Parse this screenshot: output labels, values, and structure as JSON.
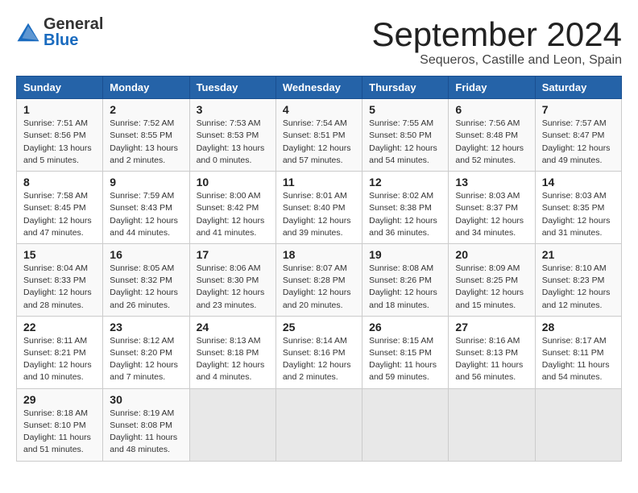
{
  "header": {
    "logo_line1": "General",
    "logo_line2": "Blue",
    "month_title": "September 2024",
    "location": "Sequeros, Castille and Leon, Spain"
  },
  "columns": [
    "Sunday",
    "Monday",
    "Tuesday",
    "Wednesday",
    "Thursday",
    "Friday",
    "Saturday"
  ],
  "weeks": [
    [
      {
        "day": "1",
        "info": "Sunrise: 7:51 AM\nSunset: 8:56 PM\nDaylight: 13 hours\nand 5 minutes."
      },
      {
        "day": "2",
        "info": "Sunrise: 7:52 AM\nSunset: 8:55 PM\nDaylight: 13 hours\nand 2 minutes."
      },
      {
        "day": "3",
        "info": "Sunrise: 7:53 AM\nSunset: 8:53 PM\nDaylight: 13 hours\nand 0 minutes."
      },
      {
        "day": "4",
        "info": "Sunrise: 7:54 AM\nSunset: 8:51 PM\nDaylight: 12 hours\nand 57 minutes."
      },
      {
        "day": "5",
        "info": "Sunrise: 7:55 AM\nSunset: 8:50 PM\nDaylight: 12 hours\nand 54 minutes."
      },
      {
        "day": "6",
        "info": "Sunrise: 7:56 AM\nSunset: 8:48 PM\nDaylight: 12 hours\nand 52 minutes."
      },
      {
        "day": "7",
        "info": "Sunrise: 7:57 AM\nSunset: 8:47 PM\nDaylight: 12 hours\nand 49 minutes."
      }
    ],
    [
      {
        "day": "8",
        "info": "Sunrise: 7:58 AM\nSunset: 8:45 PM\nDaylight: 12 hours\nand 47 minutes."
      },
      {
        "day": "9",
        "info": "Sunrise: 7:59 AM\nSunset: 8:43 PM\nDaylight: 12 hours\nand 44 minutes."
      },
      {
        "day": "10",
        "info": "Sunrise: 8:00 AM\nSunset: 8:42 PM\nDaylight: 12 hours\nand 41 minutes."
      },
      {
        "day": "11",
        "info": "Sunrise: 8:01 AM\nSunset: 8:40 PM\nDaylight: 12 hours\nand 39 minutes."
      },
      {
        "day": "12",
        "info": "Sunrise: 8:02 AM\nSunset: 8:38 PM\nDaylight: 12 hours\nand 36 minutes."
      },
      {
        "day": "13",
        "info": "Sunrise: 8:03 AM\nSunset: 8:37 PM\nDaylight: 12 hours\nand 34 minutes."
      },
      {
        "day": "14",
        "info": "Sunrise: 8:03 AM\nSunset: 8:35 PM\nDaylight: 12 hours\nand 31 minutes."
      }
    ],
    [
      {
        "day": "15",
        "info": "Sunrise: 8:04 AM\nSunset: 8:33 PM\nDaylight: 12 hours\nand 28 minutes."
      },
      {
        "day": "16",
        "info": "Sunrise: 8:05 AM\nSunset: 8:32 PM\nDaylight: 12 hours\nand 26 minutes."
      },
      {
        "day": "17",
        "info": "Sunrise: 8:06 AM\nSunset: 8:30 PM\nDaylight: 12 hours\nand 23 minutes."
      },
      {
        "day": "18",
        "info": "Sunrise: 8:07 AM\nSunset: 8:28 PM\nDaylight: 12 hours\nand 20 minutes."
      },
      {
        "day": "19",
        "info": "Sunrise: 8:08 AM\nSunset: 8:26 PM\nDaylight: 12 hours\nand 18 minutes."
      },
      {
        "day": "20",
        "info": "Sunrise: 8:09 AM\nSunset: 8:25 PM\nDaylight: 12 hours\nand 15 minutes."
      },
      {
        "day": "21",
        "info": "Sunrise: 8:10 AM\nSunset: 8:23 PM\nDaylight: 12 hours\nand 12 minutes."
      }
    ],
    [
      {
        "day": "22",
        "info": "Sunrise: 8:11 AM\nSunset: 8:21 PM\nDaylight: 12 hours\nand 10 minutes."
      },
      {
        "day": "23",
        "info": "Sunrise: 8:12 AM\nSunset: 8:20 PM\nDaylight: 12 hours\nand 7 minutes."
      },
      {
        "day": "24",
        "info": "Sunrise: 8:13 AM\nSunset: 8:18 PM\nDaylight: 12 hours\nand 4 minutes."
      },
      {
        "day": "25",
        "info": "Sunrise: 8:14 AM\nSunset: 8:16 PM\nDaylight: 12 hours\nand 2 minutes."
      },
      {
        "day": "26",
        "info": "Sunrise: 8:15 AM\nSunset: 8:15 PM\nDaylight: 11 hours\nand 59 minutes."
      },
      {
        "day": "27",
        "info": "Sunrise: 8:16 AM\nSunset: 8:13 PM\nDaylight: 11 hours\nand 56 minutes."
      },
      {
        "day": "28",
        "info": "Sunrise: 8:17 AM\nSunset: 8:11 PM\nDaylight: 11 hours\nand 54 minutes."
      }
    ],
    [
      {
        "day": "29",
        "info": "Sunrise: 8:18 AM\nSunset: 8:10 PM\nDaylight: 11 hours\nand 51 minutes."
      },
      {
        "day": "30",
        "info": "Sunrise: 8:19 AM\nSunset: 8:08 PM\nDaylight: 11 hours\nand 48 minutes."
      },
      {
        "day": "",
        "info": ""
      },
      {
        "day": "",
        "info": ""
      },
      {
        "day": "",
        "info": ""
      },
      {
        "day": "",
        "info": ""
      },
      {
        "day": "",
        "info": ""
      }
    ]
  ]
}
